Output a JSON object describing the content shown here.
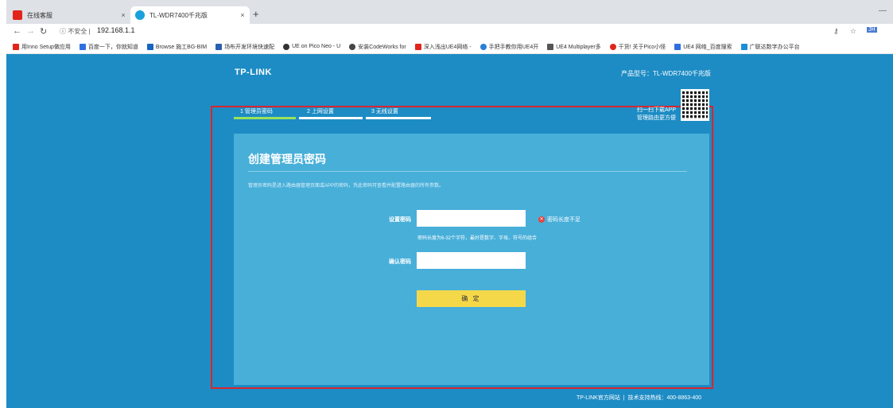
{
  "browser": {
    "tabs": [
      {
        "title": "在线客服",
        "active": false
      },
      {
        "title": "TL-WDR7400千兆版",
        "active": true
      }
    ],
    "new_tab": "+",
    "close_glyph": "×",
    "minimize_glyph": "—",
    "address": {
      "security": "不安全",
      "url": "192.168.1.1"
    },
    "bookmarks": [
      {
        "label": "用Inno Setup做应用",
        "color": "#e1251b"
      },
      {
        "label": "百度一下，你就知道",
        "color": "#2f6ee0"
      },
      {
        "label": "Browse 施工BG-BIM",
        "color": "#1565c0"
      },
      {
        "label": "场布开发环境快速配",
        "color": "#2a5fb0"
      },
      {
        "label": "UE on Pico Neo - U",
        "color": "#333333"
      },
      {
        "label": "安装CodeWorks for",
        "color": "#444444"
      },
      {
        "label": "深入浅出UE4网络 -",
        "color": "#e1251b"
      },
      {
        "label": "手把手教你用UE4开",
        "color": "#2b7fd6"
      },
      {
        "label": "UE4 Multiplayer多",
        "color": "#555555"
      },
      {
        "label": "干货! 关于Pico小怪",
        "color": "#e1251b"
      },
      {
        "label": "UE4 网络_百度搜索",
        "color": "#2f6ee0"
      },
      {
        "label": "广联达数字办公平台",
        "color": "#1a8fd8"
      }
    ]
  },
  "router": {
    "logo": "TP-LINK",
    "model": "产品型号：TL-WDR7400千兆版",
    "steps": [
      {
        "label": "1 管理员密码",
        "state": "active",
        "color": "#9be35a"
      },
      {
        "label": "2 上网设置",
        "state": "pending",
        "color": "#ffffff"
      },
      {
        "label": "3 无线设置",
        "state": "pending",
        "color": "#ffffff"
      }
    ],
    "qr_text": [
      "扫一扫下载APP",
      "管理路由更方便"
    ],
    "card": {
      "title": "创建管理员密码",
      "description": "管理员密码是进入路由器管理页面或APP的密码，凭此密码可查看并配置路由器的所有参数。",
      "set_password_label": "设置密码",
      "set_password_value": "",
      "error": "密码长度不足",
      "hint": "密码长度为6-32个字符，最好是数字、字母、符号的组合",
      "confirm_password_label": "确认密码",
      "confirm_password_value": "",
      "ok_button": "确 定"
    },
    "footer": {
      "site": "TP-LINK官方网站",
      "separator": "|",
      "hotline": "技术支持热线：400-8863-400"
    }
  },
  "colors": {
    "page_bg": "#1d8cc4",
    "card_bg": "#48afd9",
    "button": "#f5d84a",
    "error": "#e8413b",
    "highlight_border": "#d9252d"
  }
}
